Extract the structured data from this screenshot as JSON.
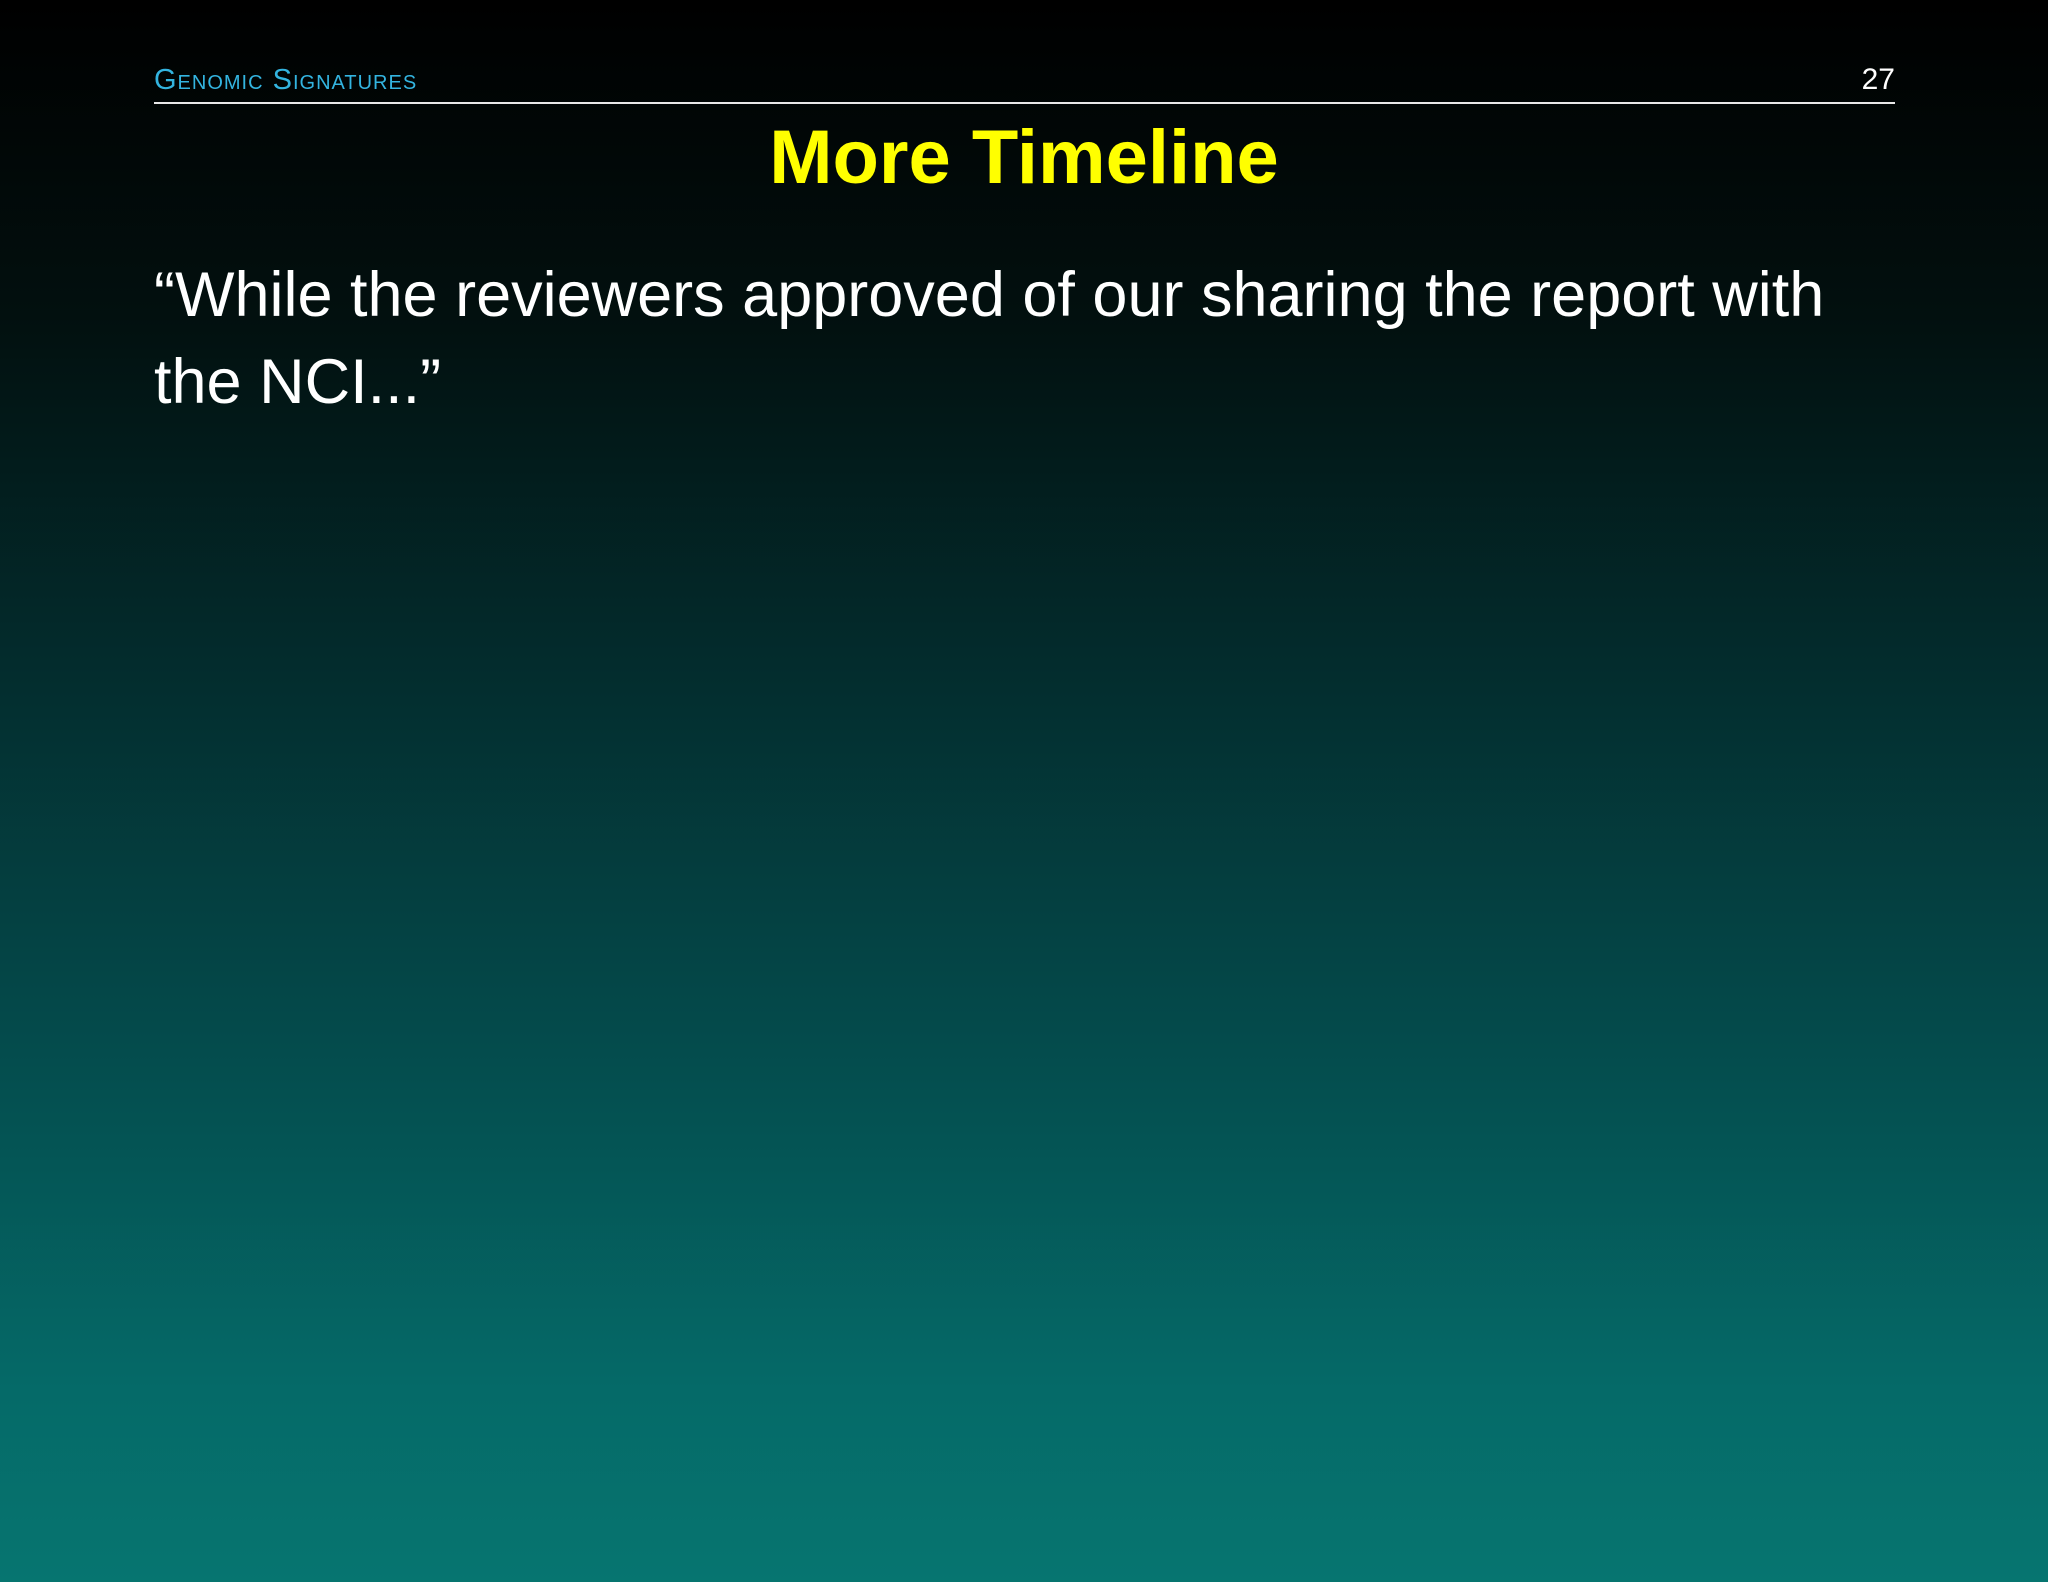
{
  "header": {
    "section": "Genomic Signatures",
    "page_number": "27"
  },
  "slide": {
    "title": "More Timeline",
    "body": "“While the reviewers approved of our sharing the report with the NCI...”"
  },
  "colors": {
    "section_title": "#33b4e0",
    "title": "#ffff00",
    "text": "#ffffff",
    "background_top": "#000000",
    "background_bottom": "#067570"
  }
}
